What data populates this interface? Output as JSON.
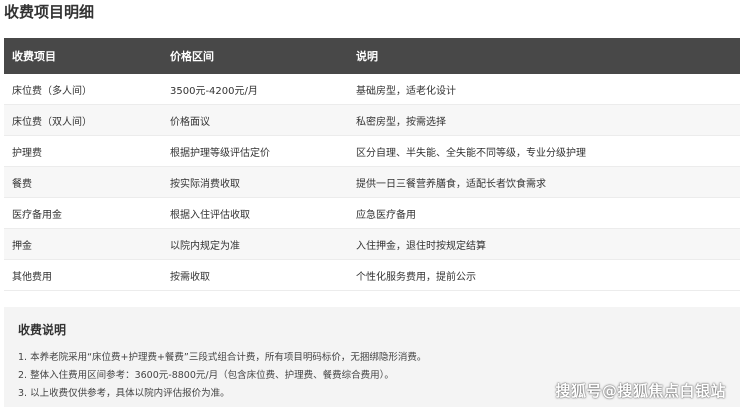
{
  "page": {
    "title": "收费项目明细"
  },
  "table": {
    "headers": [
      "收费项目",
      "价格区间",
      "说明"
    ],
    "rows": [
      [
        "床位费（多人间）",
        "3500元-4200元/月",
        "基础房型，适老化设计"
      ],
      [
        "床位费（双人间）",
        "价格面议",
        "私密房型，按需选择"
      ],
      [
        "护理费",
        "根据护理等级评估定价",
        "区分自理、半失能、全失能不同等级，专业分级护理"
      ],
      [
        "餐费",
        "按实际消费收取",
        "提供一日三餐营养膳食，适配长者饮食需求"
      ],
      [
        "医疗备用金",
        "根据入住评估收取",
        "应急医疗备用"
      ],
      [
        "押金",
        "以院内规定为准",
        "入住押金，退住时按规定结算"
      ],
      [
        "其他费用",
        "按需收取",
        "个性化服务费用，提前公示"
      ]
    ]
  },
  "notes": {
    "title": "收费说明",
    "lines": [
      "1. 本养老院采用“床位费+护理费+餐费”三段式组合计费，所有项目明码标价，无捆绑隐形消费。",
      "2. 整体入住费用区间参考：3600元-8800元/月（包含床位费、护理费、餐费综合费用）。",
      "3. 以上收费仅供参考，具体以院内评估报价为准。"
    ]
  },
  "watermark": {
    "text": "搜狐号@搜狐焦点白银站"
  },
  "colors": {
    "header_bg": "#484848",
    "row_alt_bg": "#f7f7f7",
    "notes_bg": "#f4f4f4"
  }
}
